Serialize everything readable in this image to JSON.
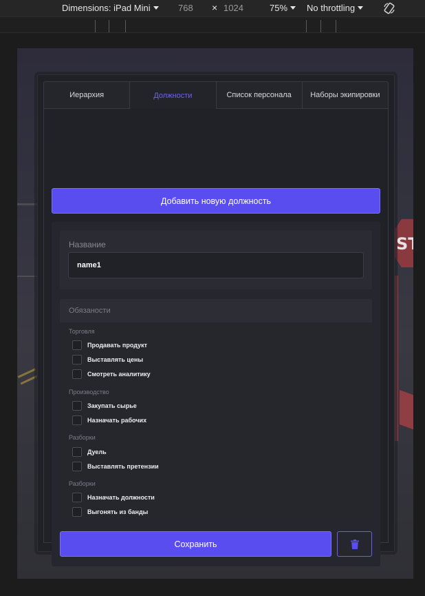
{
  "devtools": {
    "dimensions_label": "Dimensions: iPad Mini",
    "width": "768",
    "times": "×",
    "height": "1024",
    "zoom": "75%",
    "throttling": "No throttling"
  },
  "scene": {
    "sign_text": "ST"
  },
  "tabs": [
    {
      "label": "Иерархия",
      "active": false
    },
    {
      "label": "Должности",
      "active": true
    },
    {
      "label": "Список персонала",
      "active": false
    },
    {
      "label": "Наборы экипировки",
      "active": false
    }
  ],
  "add_button": "Добавить новую должность",
  "name_field": {
    "label": "Название",
    "value": "name1"
  },
  "duties": {
    "title": "Обязаности",
    "groups": [
      {
        "title": "Торговля",
        "items": [
          "Продавать продукт",
          "Выставлять цены",
          "Смотреть аналитику"
        ]
      },
      {
        "title": "Производство",
        "items": [
          "Закупать сырье",
          "Назначать рабочих"
        ]
      },
      {
        "title": "Разборки",
        "items": [
          "Дуель",
          "Выставлять претензии"
        ]
      },
      {
        "title": "Разборки",
        "items": [
          "Назначать должности",
          "Выгонять из банды"
        ]
      }
    ]
  },
  "save_button": "Сохранить",
  "icons": {
    "delete": "trash-icon",
    "rotate": "rotate-device-icon"
  },
  "colors": {
    "accent": "#5a4df0",
    "active_tab": "#6f63f0"
  }
}
